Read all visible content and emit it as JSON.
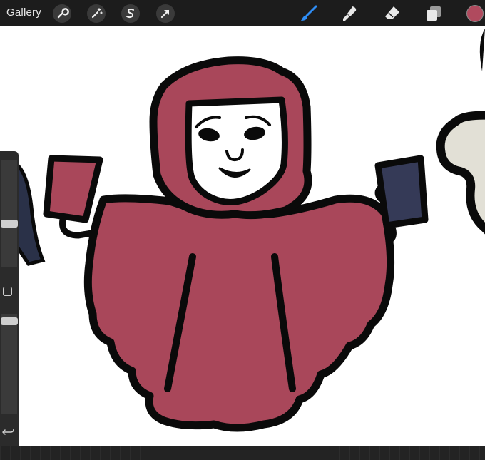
{
  "topbar": {
    "gallery_label": "Gallery",
    "left_tools": [
      "wrench-icon",
      "magic-wand-icon",
      "selection-s-icon",
      "transform-arrow-icon"
    ],
    "right_tools": [
      "brush-icon",
      "smudge-icon",
      "eraser-icon",
      "layers-icon"
    ],
    "active_tool": "brush-icon",
    "current_color": "#b04a5e"
  },
  "canvas": {
    "background": "#ffffff",
    "hood_color": "#a9475a",
    "mask_color": "#ffffff",
    "outline_color": "#0a0a0a",
    "right_book_color": "#353a57",
    "neighbor_figure_color": "#e2e0d6",
    "left_figure_color": "#2a3148"
  },
  "sidebar": {
    "icons": [
      "modify-square-icon",
      "undo-icon",
      "redo-icon"
    ]
  }
}
